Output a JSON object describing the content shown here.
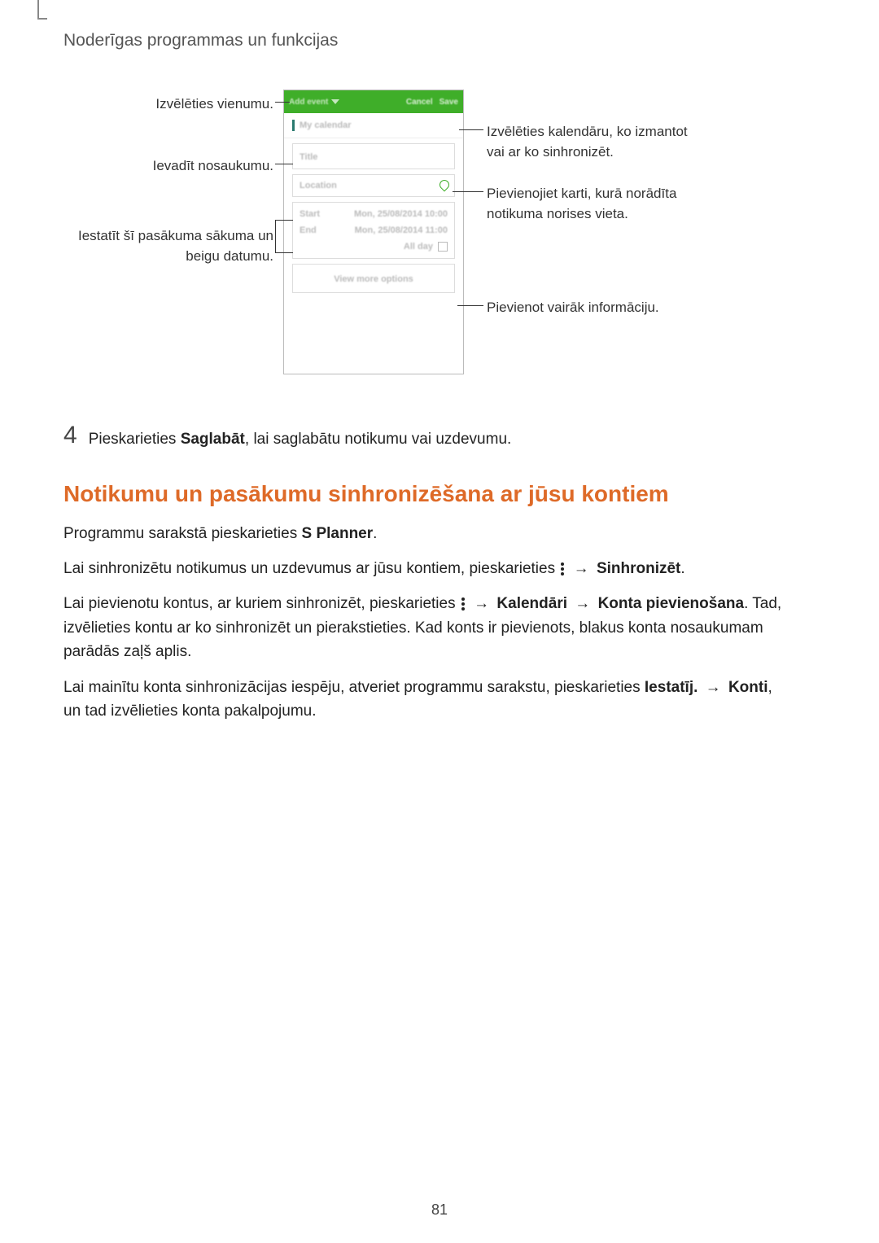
{
  "header": "Noderīgas programmas un funkcijas",
  "callouts": {
    "select_item": "Izvēlēties vienumu.",
    "enter_name": "Ievadīt nosaukumu.",
    "set_dates_line1": "Iestatīt šī pasākuma sākuma un",
    "set_dates_line2": "beigu datumu.",
    "select_cal_line1": "Izvēlēties kalendāru, ko izmantot",
    "select_cal_line2": "vai ar ko sinhronizēt.",
    "attach_map_line1": "Pievienojiet karti, kurā norādīta",
    "attach_map_line2": "notikuma norises vieta.",
    "add_more": "Pievienot vairāk informāciju."
  },
  "phone": {
    "add_event": "Add event",
    "cancel": "Cancel",
    "save": "Save",
    "my_calendar": "My calendar",
    "title": "Title",
    "location": "Location",
    "start": "Start",
    "end": "End",
    "date_start": "Mon, 25/08/2014   10:00",
    "date_end": "Mon, 25/08/2014   11:00",
    "all_day": "All day",
    "view_more": "View more options"
  },
  "step4": {
    "num": "4",
    "pre": "Pieskarieties ",
    "bold": "Saglabāt",
    "post": ", lai saglabātu notikumu vai uzdevumu."
  },
  "h2": "Notikumu un pasākumu sinhronizēšana ar jūsu kontiem",
  "p1": {
    "pre": "Programmu sarakstā pieskarieties ",
    "bold": "S Planner",
    "post": "."
  },
  "p2": {
    "pre": "Lai sinhronizētu notikumus un uzdevumus ar jūsu kontiem, pieskarieties ",
    "arrow": " → ",
    "bold": "Sinhronizēt",
    "post": "."
  },
  "p3": {
    "pre": "Lai pievienotu kontus, ar kuriem sinhronizēt, pieskarieties ",
    "arrow": " → ",
    "b1": "Kalendāri",
    "b2": "Konta pievienošana",
    "post": ". Tad, izvēlieties kontu ar ko sinhronizēt un pierakstieties. Kad konts ir pievienots, blakus konta nosaukumam parādās zaļš aplis."
  },
  "p4": {
    "pre": "Lai mainītu konta sinhronizācijas iespēju, atveriet programmu sarakstu, pieskarieties ",
    "b1": "Iestatīj.",
    "arrow": " → ",
    "b2": "Konti",
    "post": ", un tad izvēlieties konta pakalpojumu."
  },
  "page_number": "81"
}
